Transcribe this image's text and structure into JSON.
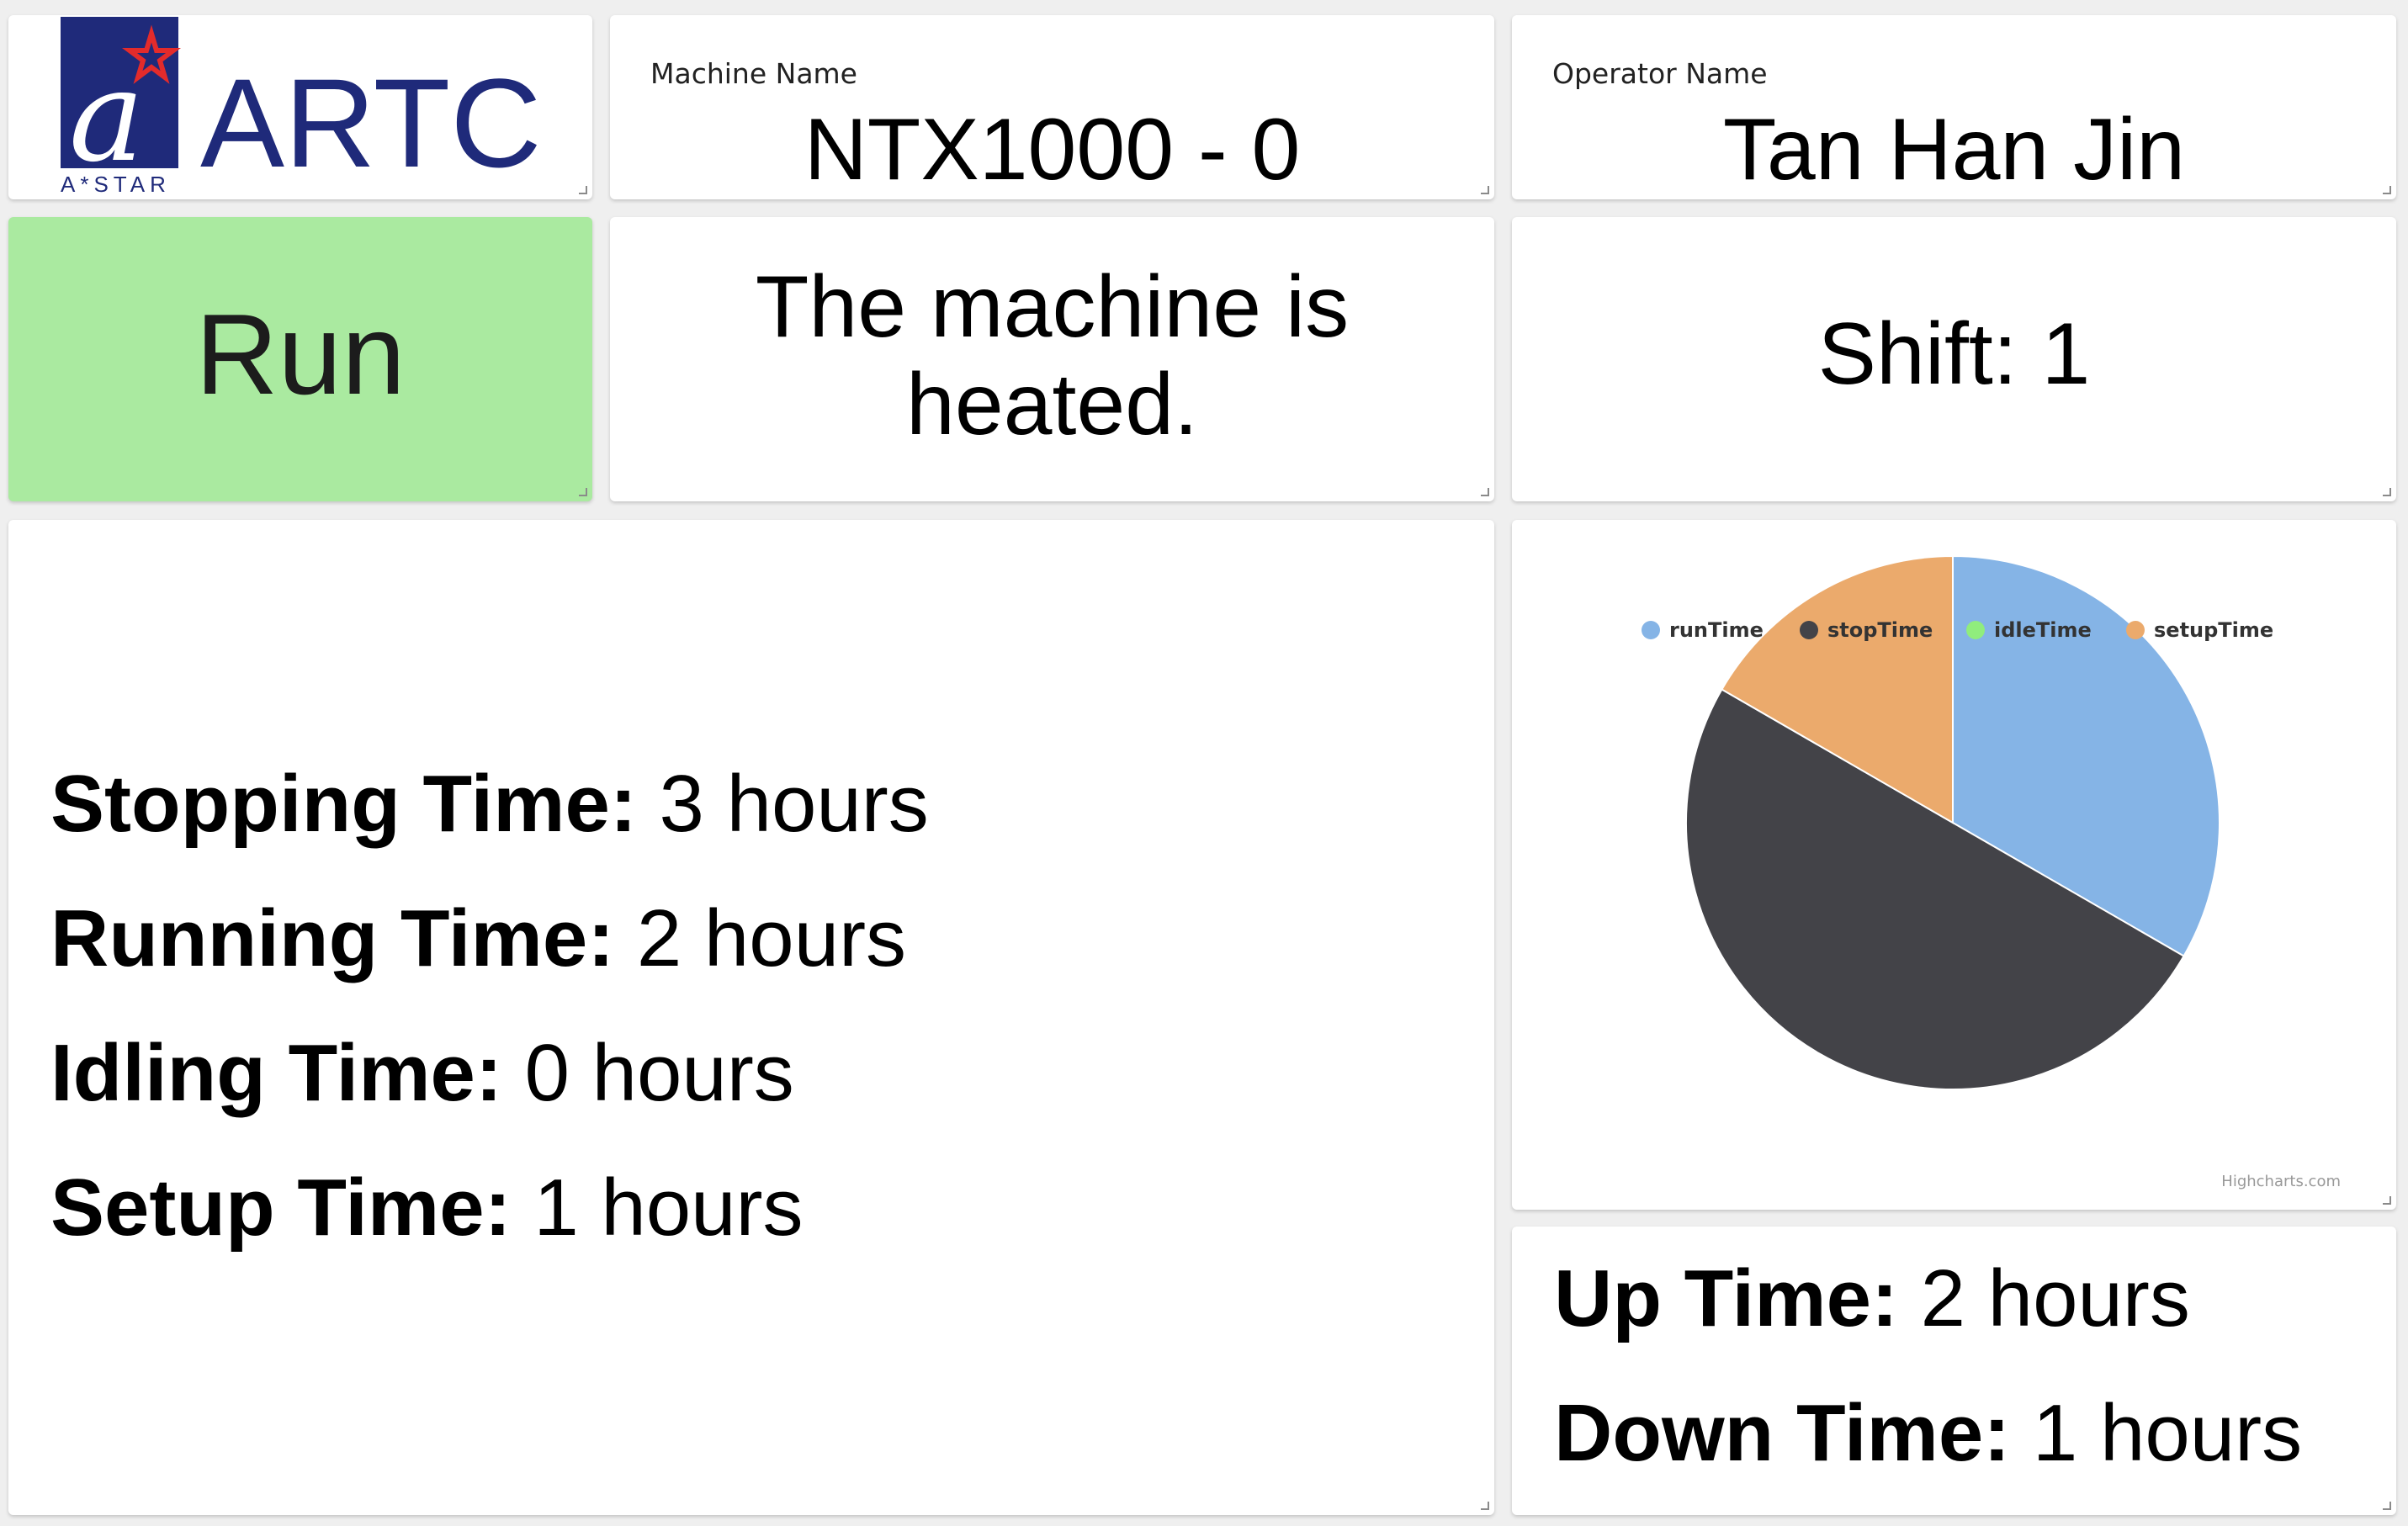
{
  "logo": {
    "name": "ARTC",
    "sub": "A*STAR"
  },
  "machine": {
    "label": "Machine Name",
    "value": "NTX1000 - 0"
  },
  "operator": {
    "label": "Operator Name",
    "value": "Tan Han Jin"
  },
  "status": {
    "text": "Run",
    "color": "#aaeaa0"
  },
  "message": {
    "line1": "The machine is",
    "line2": "heated."
  },
  "shift": {
    "text": "Shift: 1"
  },
  "times": {
    "stopping": {
      "label": "Stopping Time:",
      "value": "3 hours"
    },
    "running": {
      "label": "Running Time:",
      "value": "2 hours"
    },
    "idling": {
      "label": "Idling Time:",
      "value": "0 hours"
    },
    "setup": {
      "label": "Setup Time:",
      "value": "1 hours"
    }
  },
  "updown": {
    "up": {
      "label": "Up Time:",
      "value": "2 hours"
    },
    "down": {
      "label": "Down Time:",
      "value": "1 hours"
    }
  },
  "chart_data": {
    "type": "pie",
    "categories": [
      "runTime",
      "stopTime",
      "idleTime",
      "setupTime"
    ],
    "values": [
      2,
      3,
      0,
      1
    ],
    "colors": [
      "#85b4e6",
      "#434348",
      "#90ed7d",
      "#ebaa6c"
    ],
    "credit": "Highcharts.com",
    "legend": "bottom"
  }
}
